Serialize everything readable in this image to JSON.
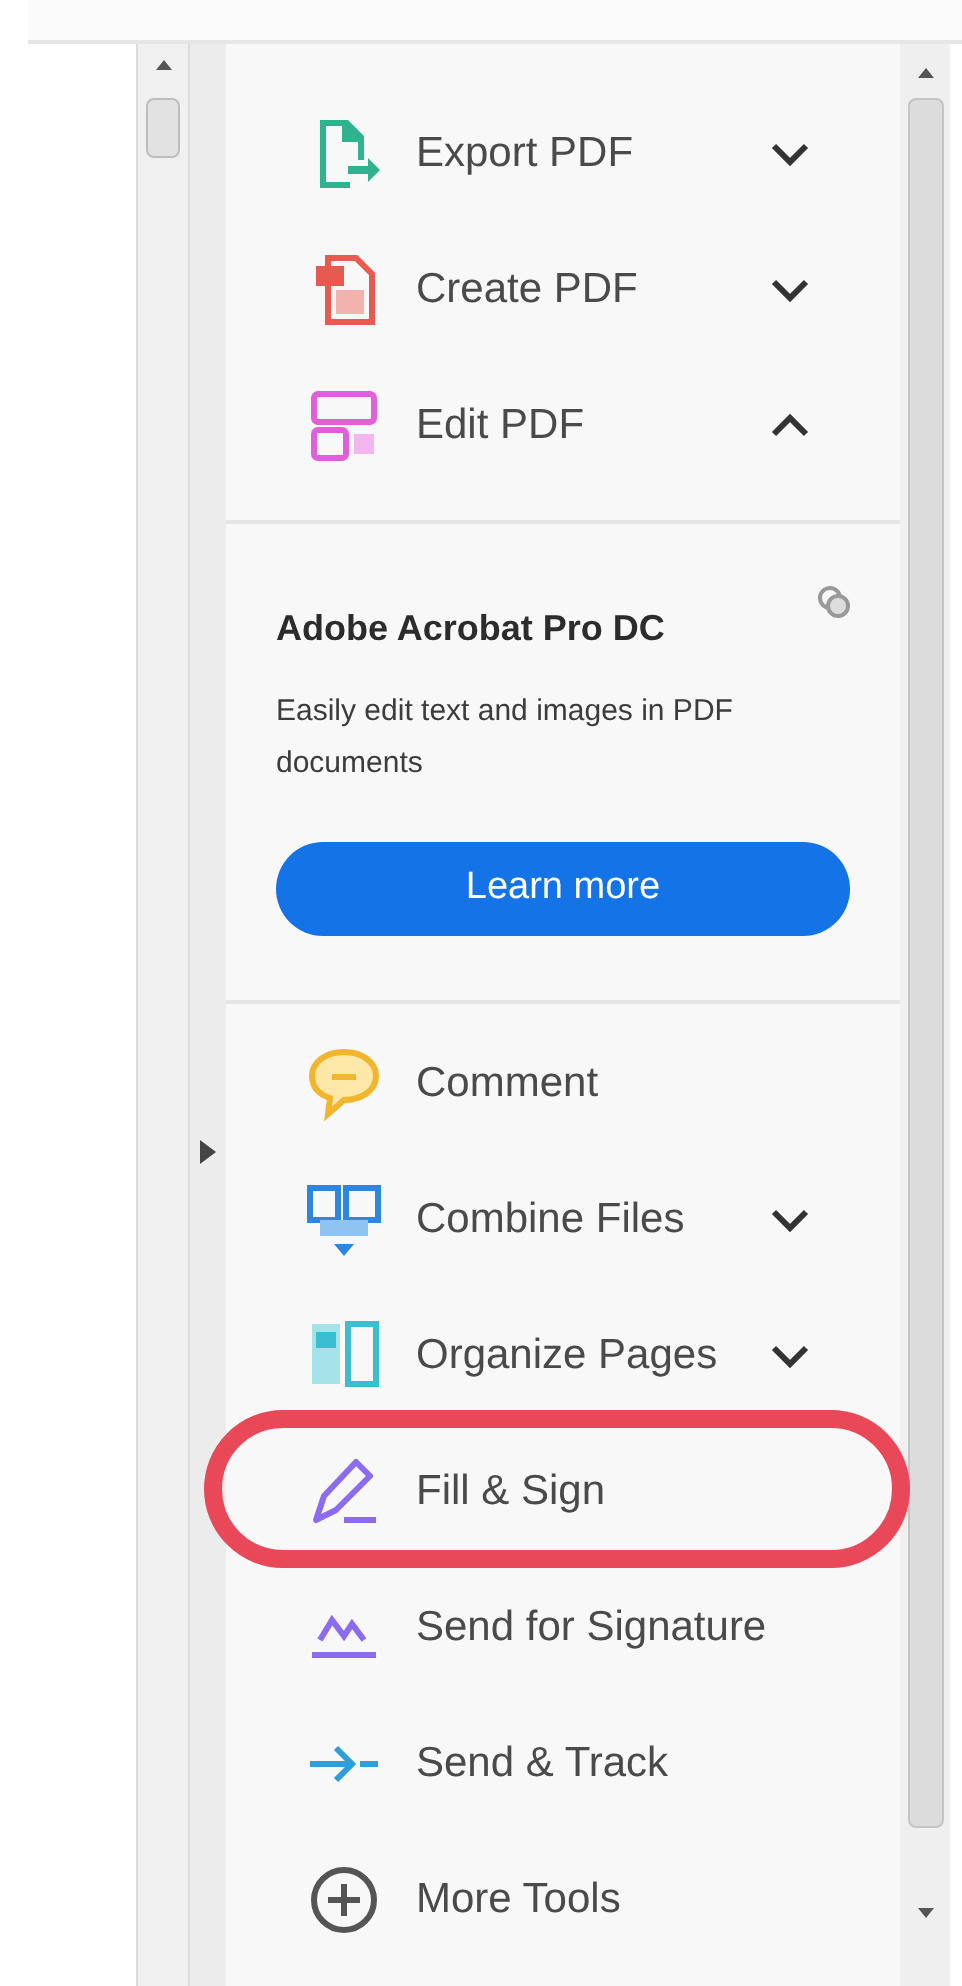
{
  "tools_top": [
    {
      "label": "Export PDF",
      "kind": "export",
      "expanded": false
    },
    {
      "label": "Create PDF",
      "kind": "create",
      "expanded": false
    },
    {
      "label": "Edit PDF",
      "kind": "edit",
      "expanded": true
    }
  ],
  "promo": {
    "title": "Adobe Acrobat Pro DC",
    "description": "Easily edit text and images in PDF documents",
    "button": "Learn more"
  },
  "tools_bottom": [
    {
      "label": "Comment",
      "kind": "comment",
      "highlighted": false
    },
    {
      "label": "Combine Files",
      "kind": "combine",
      "expanded": false,
      "highlighted": false
    },
    {
      "label": "Organize Pages",
      "kind": "organize",
      "expanded": false,
      "highlighted": false
    },
    {
      "label": "Fill & Sign",
      "kind": "fill",
      "highlighted": true
    },
    {
      "label": "Send for Signature",
      "kind": "sendsig",
      "highlighted": false
    },
    {
      "label": "Send & Track",
      "kind": "track",
      "highlighted": false
    },
    {
      "label": "More Tools",
      "kind": "more",
      "highlighted": false
    }
  ]
}
